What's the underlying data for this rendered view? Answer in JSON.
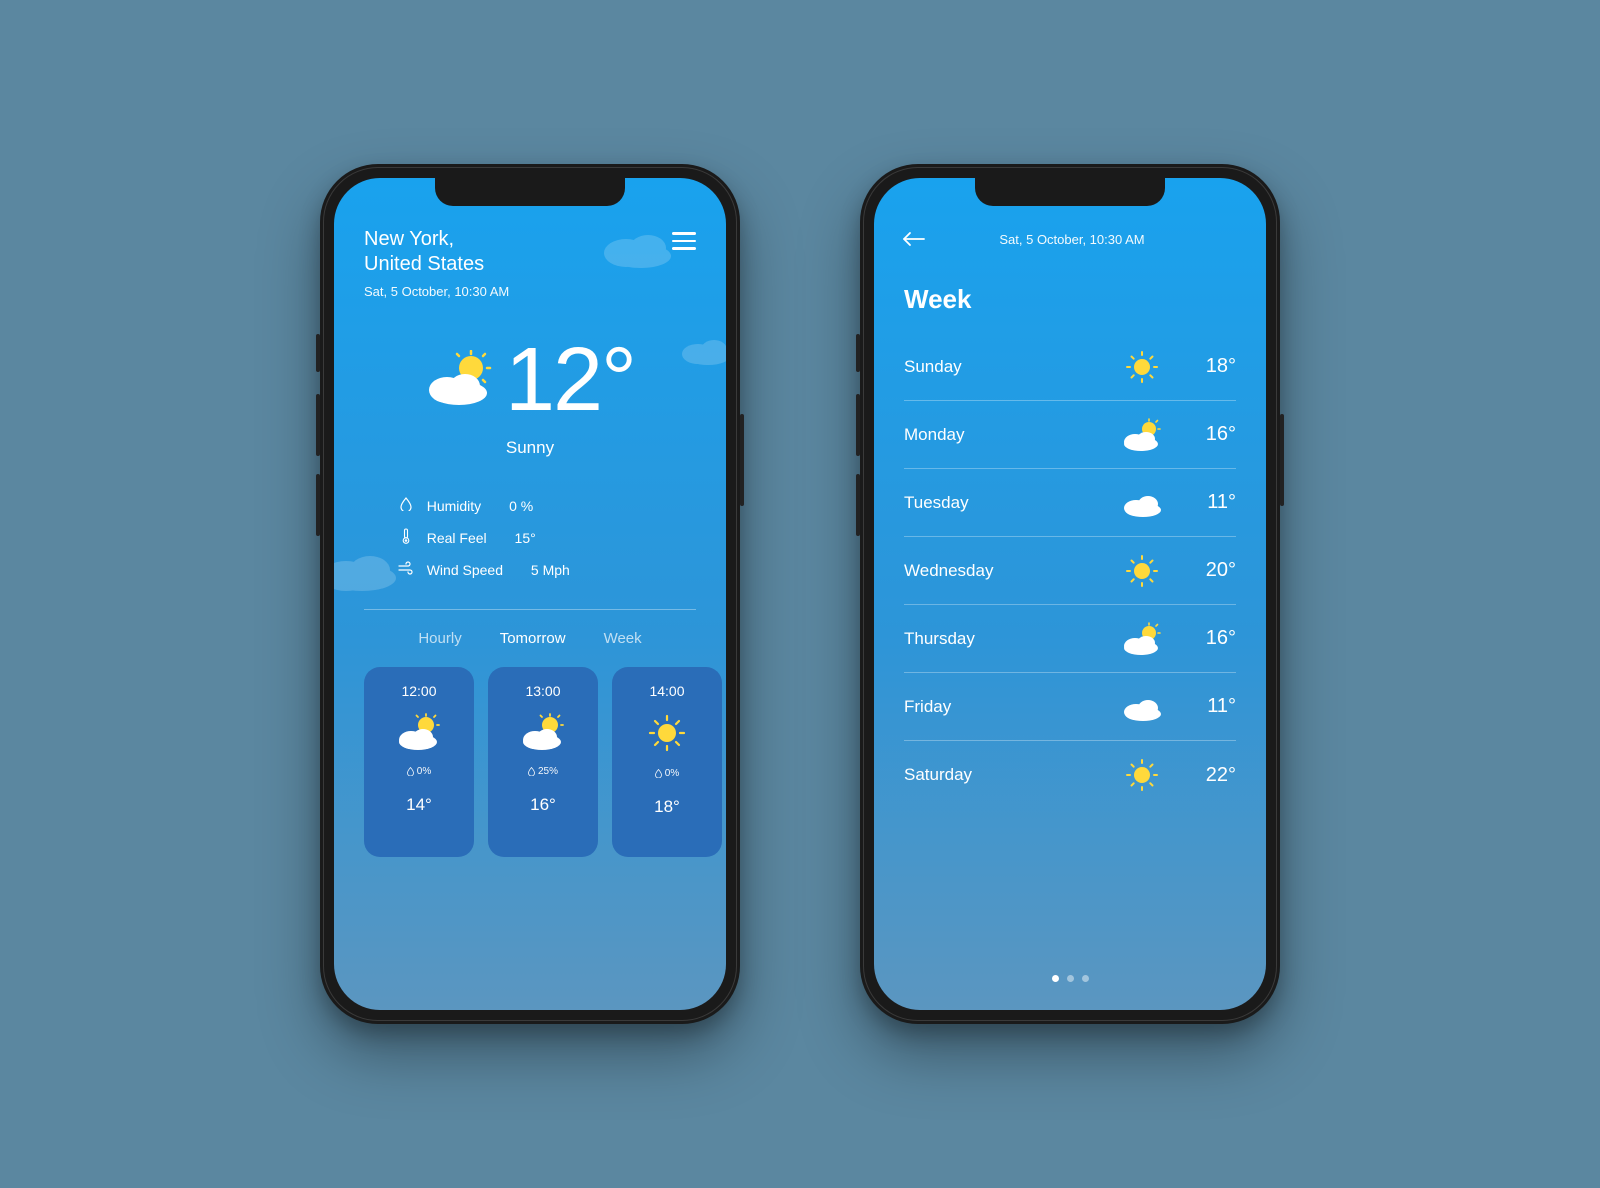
{
  "screen1": {
    "location_city": "New York,",
    "location_country": "United States",
    "datetime": "Sat, 5 October, 10:30 AM",
    "temperature": "12°",
    "condition": "Sunny",
    "metrics": {
      "humidity_label": "Humidity",
      "humidity_value": "0 %",
      "realfeel_label": "Real Feel",
      "realfeel_value": "15°",
      "wind_label": "Wind Speed",
      "wind_value": "5 Mph"
    },
    "tabs": {
      "hourly": "Hourly",
      "tomorrow": "Tomorrow",
      "week": "Week"
    },
    "hourly": [
      {
        "time": "12:00",
        "icon": "partly-cloudy",
        "humidity": "0%",
        "temp": "14°"
      },
      {
        "time": "13:00",
        "icon": "partly-cloudy",
        "humidity": "25%",
        "temp": "16°"
      },
      {
        "time": "14:00",
        "icon": "sunny",
        "humidity": "0%",
        "temp": "18°"
      }
    ]
  },
  "screen2": {
    "datetime": "Sat, 5 October, 10:30 AM",
    "title": "Week",
    "days": [
      {
        "name": "Sunday",
        "icon": "sunny",
        "temp": "18°"
      },
      {
        "name": "Monday",
        "icon": "partly-cloudy",
        "temp": "16°"
      },
      {
        "name": "Tuesday",
        "icon": "cloudy",
        "temp": "11°"
      },
      {
        "name": "Wednesday",
        "icon": "sunny",
        "temp": "20°"
      },
      {
        "name": "Thursday",
        "icon": "partly-cloudy",
        "temp": "16°"
      },
      {
        "name": "Friday",
        "icon": "cloudy",
        "temp": "11°"
      },
      {
        "name": "Saturday",
        "icon": "sunny",
        "temp": "22°"
      }
    ]
  }
}
